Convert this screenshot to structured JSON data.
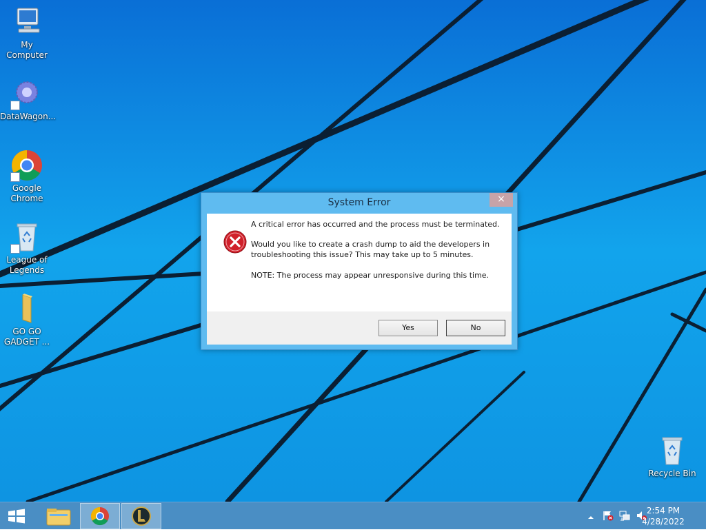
{
  "desktop": {
    "icons": [
      {
        "label": "My Computer",
        "icon": "computer-icon"
      },
      {
        "label": "DataWagon...",
        "icon": "gear-cog-icon"
      },
      {
        "label": "Google Chrome",
        "icon": "chrome-icon"
      },
      {
        "label": "League of Legends",
        "icon": "recycle-bin-icon"
      },
      {
        "label": "GO GO GADGET ...",
        "icon": "folder-icon"
      }
    ],
    "recycle_bin": {
      "label": "Recycle Bin",
      "icon": "recycle-bin-icon"
    }
  },
  "dialog": {
    "title": "System Error",
    "close_glyph": "×",
    "message_line1": "A critical error has occurred and the process must be terminated.",
    "message_line2a": "Would you like to create a crash dump to aid the developers in",
    "message_line2b": "troubleshooting this issue? This may take up to 5 minutes.",
    "message_line3": "NOTE: The process may appear unresponsive during this time.",
    "yes_label": "Yes",
    "no_label": "No"
  },
  "taskbar": {
    "items": [
      "start-icon",
      "file-explorer-icon",
      "chrome-icon",
      "league-of-legends-icon"
    ],
    "tray": [
      "show-hidden-icons-chevron",
      "action-center-flag-icon",
      "network-icon",
      "volume-muted-icon"
    ],
    "time": "2:54 PM",
    "date": "4/28/2022"
  },
  "colors": {
    "desktop_blue": "#0f9ae6",
    "dialog_frame": "#5fbbf0",
    "taskbar": "#4a8ec4",
    "error_red": "#d0202a"
  }
}
